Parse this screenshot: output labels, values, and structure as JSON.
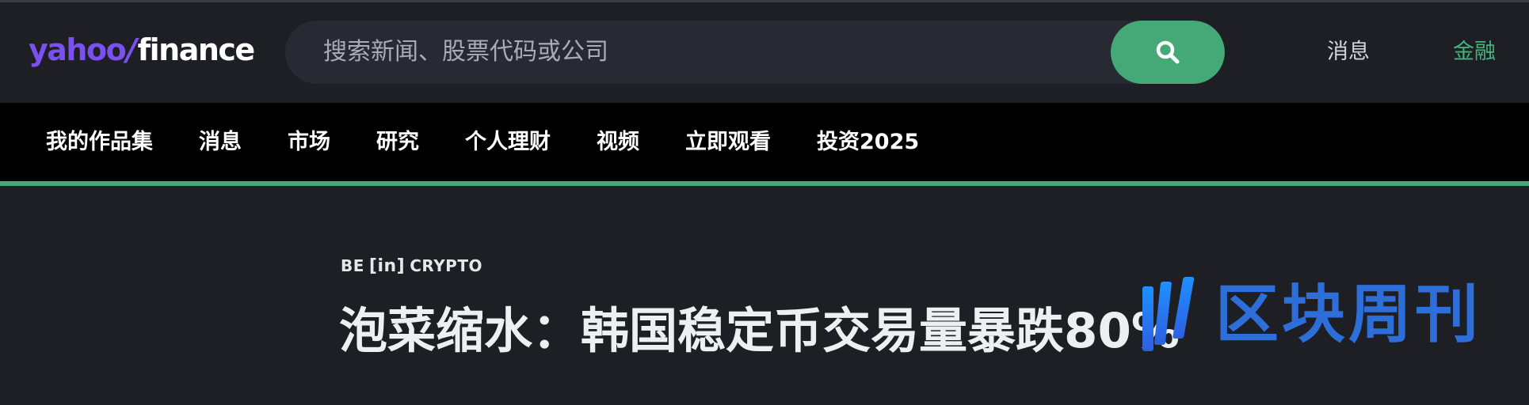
{
  "header": {
    "logo": {
      "part1": "yahoo",
      "slash": "/",
      "part2": "finance"
    },
    "search": {
      "placeholder": "搜索新闻、股票代码或公司",
      "button_icon": "search-icon"
    },
    "links": {
      "news": "消息",
      "finance": "金融"
    }
  },
  "nav": {
    "items": [
      {
        "label": "我的作品集"
      },
      {
        "label": "消息"
      },
      {
        "label": "市场"
      },
      {
        "label": "研究"
      },
      {
        "label": "个人理财"
      },
      {
        "label": "视频"
      },
      {
        "label": "立即观看"
      },
      {
        "label": "投资2025"
      }
    ]
  },
  "article": {
    "source": {
      "pre": "BE",
      "mid": "[in]",
      "post": "CRYPTO"
    },
    "headline": "泡菜缩水：韩国稳定币交易量暴跌80%"
  },
  "watermark": {
    "text": "区块周刊"
  },
  "colors": {
    "accent_green": "#44a976",
    "logo_purple": "#7b50f0",
    "background": "#1d1f25",
    "nav_background": "#000000",
    "watermark_blue": "#2f73e2"
  }
}
